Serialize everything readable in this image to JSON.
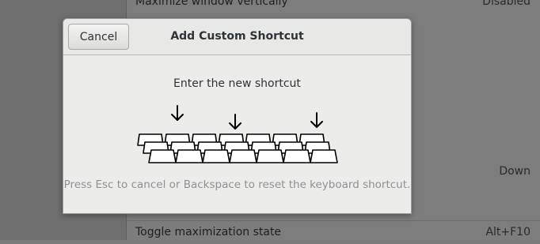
{
  "background": {
    "rows": [
      {
        "name": "Maximize window vertically",
        "accel": "Disabled"
      },
      {
        "name": "",
        "accel": "Down"
      },
      {
        "name": "Toggle maximization state",
        "accel": "Alt+F10"
      }
    ]
  },
  "dialog": {
    "cancel_label": "Cancel",
    "title": "Add Custom Shortcut",
    "prompt": "Enter the new shortcut",
    "hint": "Press Esc to cancel or Backspace to reset the keyboard shortcut."
  },
  "colors": {
    "dialog_bg": "#ececea",
    "hint_text": "#8e9192",
    "primary_text": "#2e3436"
  }
}
